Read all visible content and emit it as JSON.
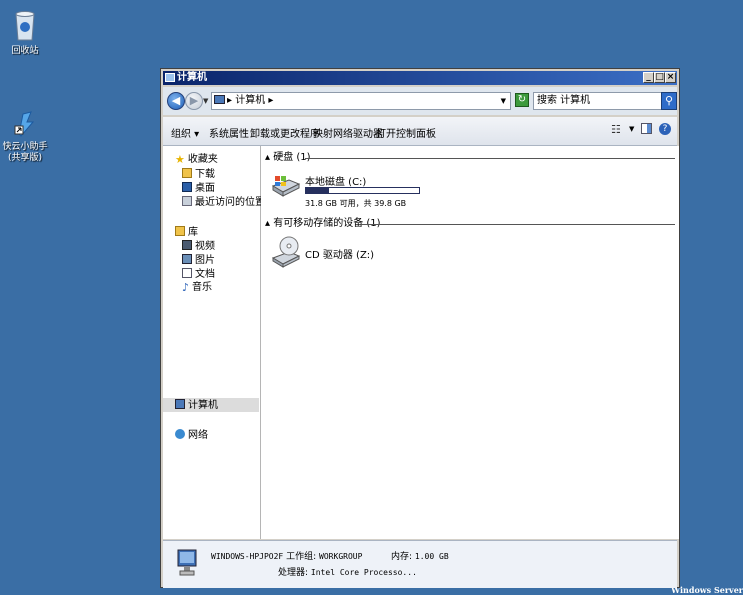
{
  "desktop": {
    "recycle_bin_label": "回收站",
    "shortcut_label": "快云小助手(共享版)",
    "watermark": "Windows Server"
  },
  "window": {
    "title": "计算机",
    "address": {
      "path_label": "计算机",
      "separator": "▸"
    },
    "search": {
      "placeholder": "搜索 计算机"
    },
    "toolbar": {
      "organize": "组织 ▾",
      "properties": "系统属性",
      "uninstall": "卸载或更改程序",
      "map_drive": "映射网络驱动器",
      "control_panel": "打开控制面板"
    },
    "nav": {
      "favorites": "收藏夹",
      "downloads": "下载",
      "desktop": "桌面",
      "recent": "最近访问的位置",
      "libraries": "库",
      "videos": "视频",
      "pictures": "图片",
      "documents": "文档",
      "music": "音乐",
      "computer": "计算机",
      "network": "网络"
    },
    "content": {
      "hdd_group": "▴ 硬盘 (1)",
      "removable_group": "▴ 有可移动存储的设备 (1)",
      "local_disk": {
        "name": "本地磁盘 (C:)",
        "capacity_text": "31.8 GB 可用，共 39.8 GB",
        "used_fraction": 0.2
      },
      "cd_drive": {
        "name": "CD 驱动器 (Z:)"
      }
    },
    "details": {
      "computer_name": "WINDOWS-HPJPO2F",
      "workgroup_label": "工作组:",
      "workgroup": "WORKGROUP",
      "memory_label": "内存:",
      "memory": "1.00 GB",
      "processor_label": "处理器:",
      "processor": "Intel Core Processo..."
    }
  },
  "colors": {
    "desktop_bg": "#3a6ea5",
    "titlebar": "#0a246a",
    "capacity_fill": "#26305e"
  }
}
